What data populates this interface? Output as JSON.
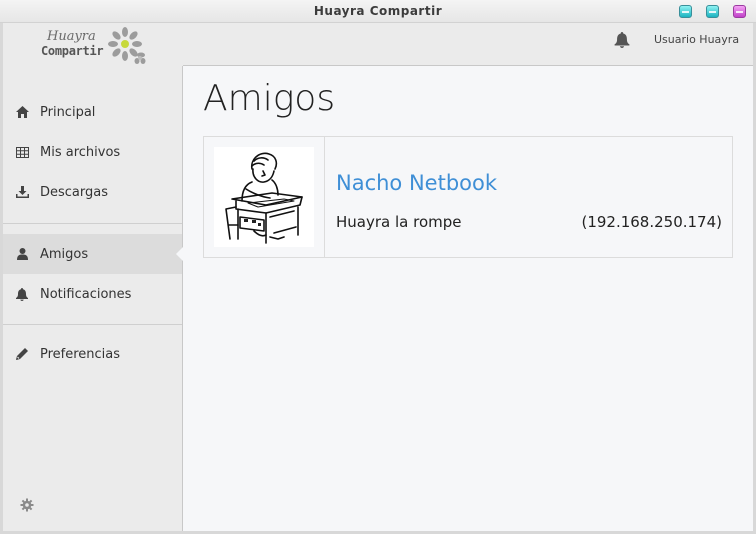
{
  "window": {
    "title": "Huayra Compartir"
  },
  "logo": {
    "line1": "Huayra",
    "line2": "Compartir"
  },
  "header": {
    "user_name": "Usuario Huayra"
  },
  "sidebar": {
    "items": [
      {
        "label": "Principal",
        "icon": "home-icon"
      },
      {
        "label": "Mis archivos",
        "icon": "table-icon"
      },
      {
        "label": "Descargas",
        "icon": "download-icon"
      },
      {
        "label": "Amigos",
        "icon": "user-icon",
        "active": true
      },
      {
        "label": "Notificaciones",
        "icon": "bell-icon"
      },
      {
        "label": "Preferencias",
        "icon": "pencil-icon"
      }
    ]
  },
  "main": {
    "title": "Amigos",
    "friends": [
      {
        "name": "Nacho Netbook",
        "status": "Huayra la rompe",
        "ip": "(192.168.250.174)"
      }
    ]
  },
  "colors": {
    "link": "#3f8fd6",
    "sidebar_bg": "#ebebeb",
    "main_bg": "#f6f7f9",
    "active_bg": "#dcdcdc"
  }
}
